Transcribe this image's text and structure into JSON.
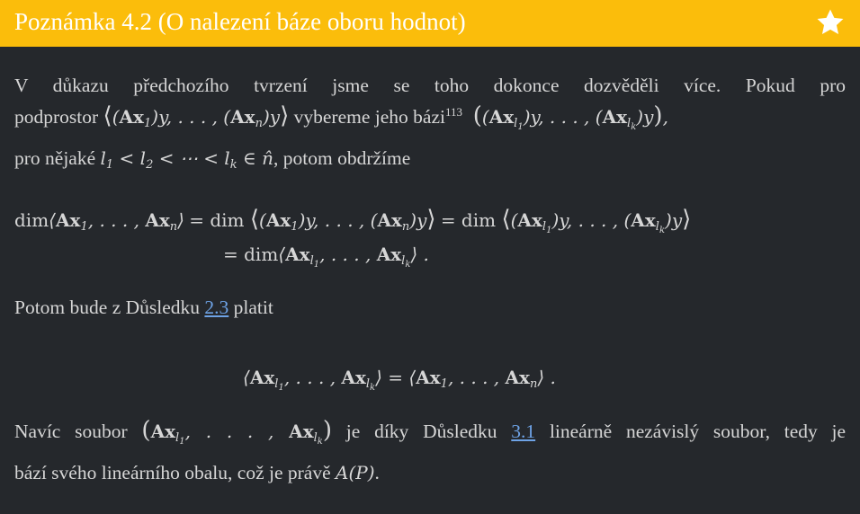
{
  "header": {
    "title": "Poznámka 4.2 (O nalezení báze oboru hodnot)",
    "background": "#fbbd0b",
    "icon": "star-icon"
  },
  "p1": {
    "t1": "V důkazu předchozího tvrzení jsme se toho dokonce dozvěděli více. Pokud pro",
    "t2": "podprostor",
    "t3": "vybereme jeho bázi",
    "footnote": "113",
    "t4": "pro nějaké",
    "t5": ", potom obdržíme"
  },
  "p2": {
    "t1": "Potom bude z Důsledku",
    "ref": "2.3",
    "t2": "platit"
  },
  "p3": {
    "t1": "Navíc soubor",
    "t2": "je díky Důsledku",
    "ref": "3.1",
    "t3": "lineárně nezávislý soubor, tedy je",
    "t4": "bází svého lineárního obalu, což je právě",
    "t5": "A(P)",
    "t6": "."
  },
  "colors": {
    "background": "#25282c",
    "text": "#d6d6d6",
    "link": "#6ea3e6"
  }
}
